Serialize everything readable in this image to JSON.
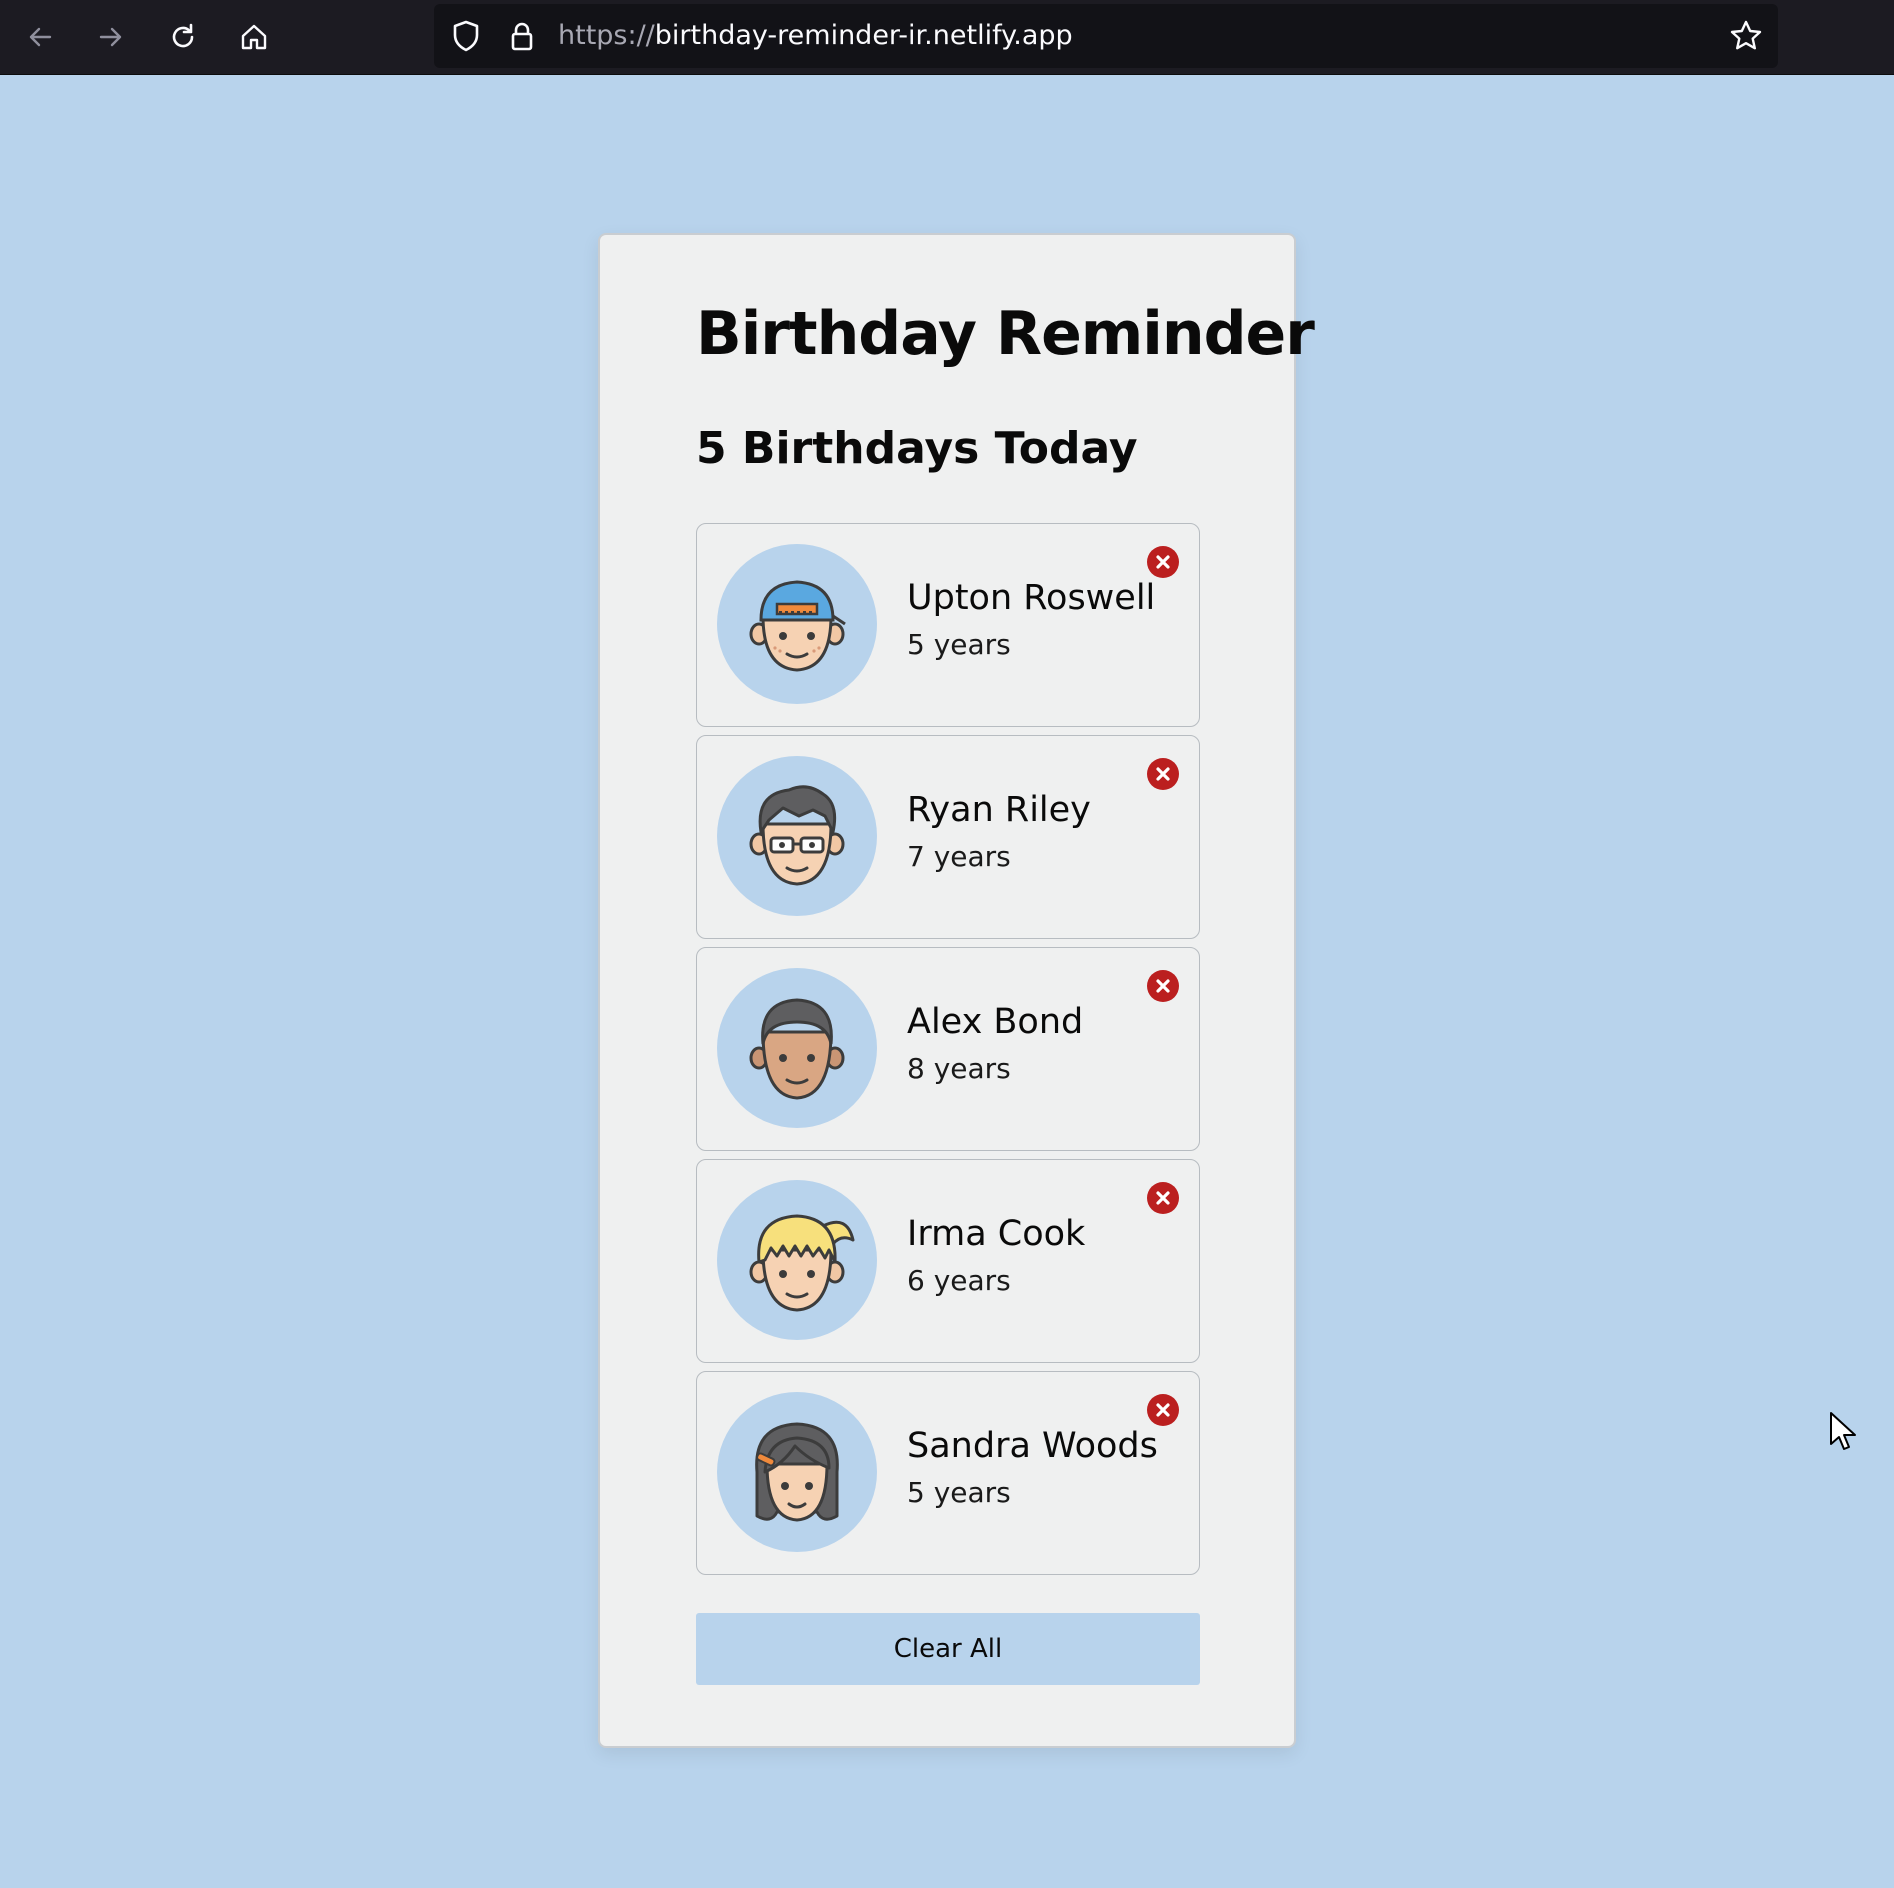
{
  "browser": {
    "url_protocol": "https://",
    "url_host": "birthday-reminder-ir.netlify.app"
  },
  "app": {
    "title": "Birthday Reminder",
    "count_label": "5 Birthdays Today",
    "clear_label": "Clear All"
  },
  "people": [
    {
      "name": "Upton Roswell",
      "age": "5 years",
      "avatar_icon": "boy-cap-avatar-icon"
    },
    {
      "name": "Ryan Riley",
      "age": "7 years",
      "avatar_icon": "man-glasses-avatar-icon"
    },
    {
      "name": "Alex Bond",
      "age": "8 years",
      "avatar_icon": "man-avatar-icon"
    },
    {
      "name": "Irma Cook",
      "age": "6 years",
      "avatar_icon": "girl-ponytail-avatar-icon"
    },
    {
      "name": "Sandra Woods",
      "age": "5 years",
      "avatar_icon": "woman-avatar-icon"
    }
  ],
  "colors": {
    "background": "#b8d3ec",
    "card": "#eff0f0",
    "remove_button": "#bb1f1f",
    "chrome": "#1c1b22"
  }
}
